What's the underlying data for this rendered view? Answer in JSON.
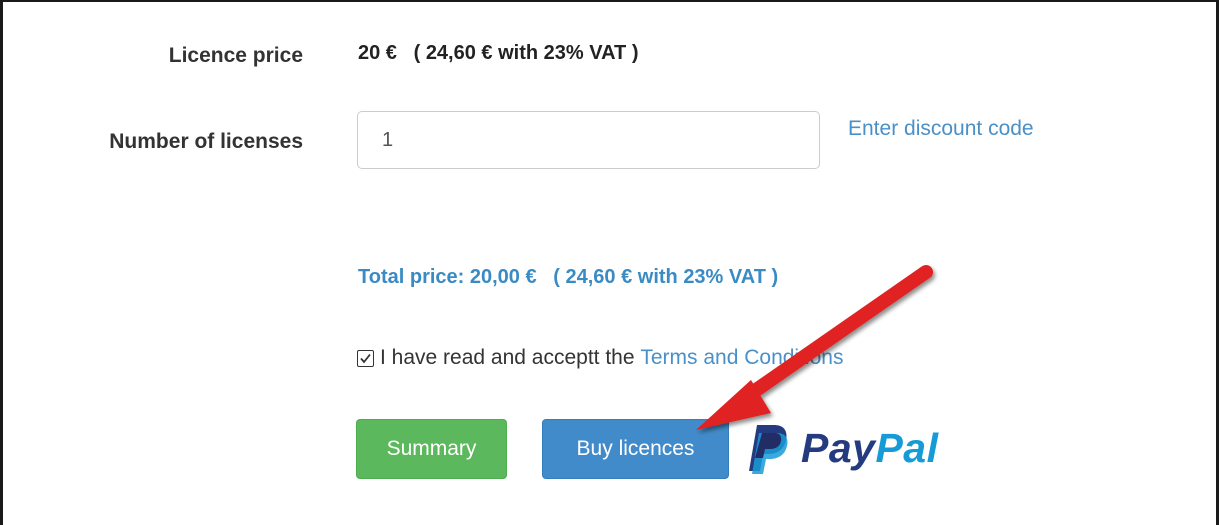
{
  "form": {
    "licence_price_label": "Licence price",
    "licence_price_value": "20 €   ( 24,60 € with 23% VAT )",
    "number_label": "Number of licenses",
    "number_value": "1",
    "discount_link": "Enter discount code",
    "total_price": "Total price: 20,00 €   ( 24,60 € with 23% VAT )",
    "agree_text": "I have read and acceptt the ",
    "terms_link": "Terms and Conditions",
    "agree_checked": true
  },
  "buttons": {
    "summary_label": "Summary",
    "buy_label": "Buy licences"
  },
  "paypal": {
    "logo_text_pay": "Pay",
    "logo_text_pal": "Pal",
    "icon": "paypal-p-icon"
  },
  "annotation": {
    "icon": "red-arrow-icon",
    "color": "#e02020"
  },
  "colors": {
    "link": "#4a90c8",
    "summary_button": "#5cb85c",
    "buy_button": "#428bca",
    "paypal_dark": "#253b80",
    "paypal_light": "#179bd7"
  }
}
